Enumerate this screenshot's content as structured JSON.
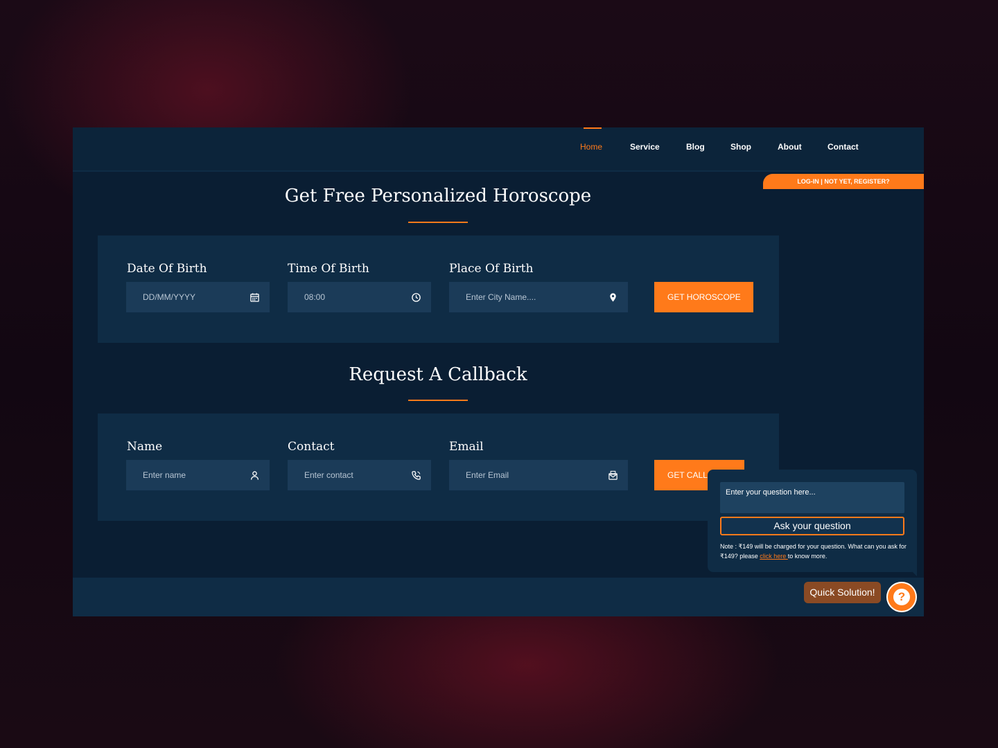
{
  "nav": {
    "items": [
      {
        "label": "Home",
        "active": true
      },
      {
        "label": "Service",
        "active": false
      },
      {
        "label": "Blog",
        "active": false
      },
      {
        "label": "Shop",
        "active": false
      },
      {
        "label": "About",
        "active": false
      },
      {
        "label": "Contact",
        "active": false
      }
    ],
    "login_label": "LOG-IN | NOT YET, REGISTER?"
  },
  "horoscope": {
    "title": "Get Free Personalized Horoscope",
    "fields": [
      {
        "label": "Date Of Birth",
        "placeholder": "DD/MM/YYYY",
        "icon": "calendar-icon"
      },
      {
        "label": "Time Of Birth",
        "value": "08:00",
        "icon": "clock-icon"
      },
      {
        "label": "Place Of Birth",
        "placeholder": "Enter City Name....",
        "icon": "location-pin-icon"
      }
    ],
    "button_label": "GET HOROSCOPE"
  },
  "callback": {
    "title": "Request A Callback",
    "fields": [
      {
        "label": "Name",
        "placeholder": "Enter name",
        "icon": "user-icon"
      },
      {
        "label": "Contact",
        "placeholder": "Enter contact",
        "icon": "phone-icon"
      },
      {
        "label": "Email",
        "placeholder": "Enter Email",
        "icon": "envelope-icon"
      }
    ],
    "button_label": "GET CALL"
  },
  "chat": {
    "input_placeholder": "Enter your question here...",
    "ask_button": "Ask your question",
    "note_before": "Note : ₹149 will be charged for your question. What can you ask for ₹149? please ",
    "note_link": "click here ",
    "note_after": "to know more.",
    "quick_label": "Quick Solution!",
    "help_glyph": "?"
  },
  "colors": {
    "accent": "#ff7a1a",
    "page_bg": "#0a1e33",
    "panel_bg": "#0f2c45",
    "input_bg": "#1b3b58"
  }
}
